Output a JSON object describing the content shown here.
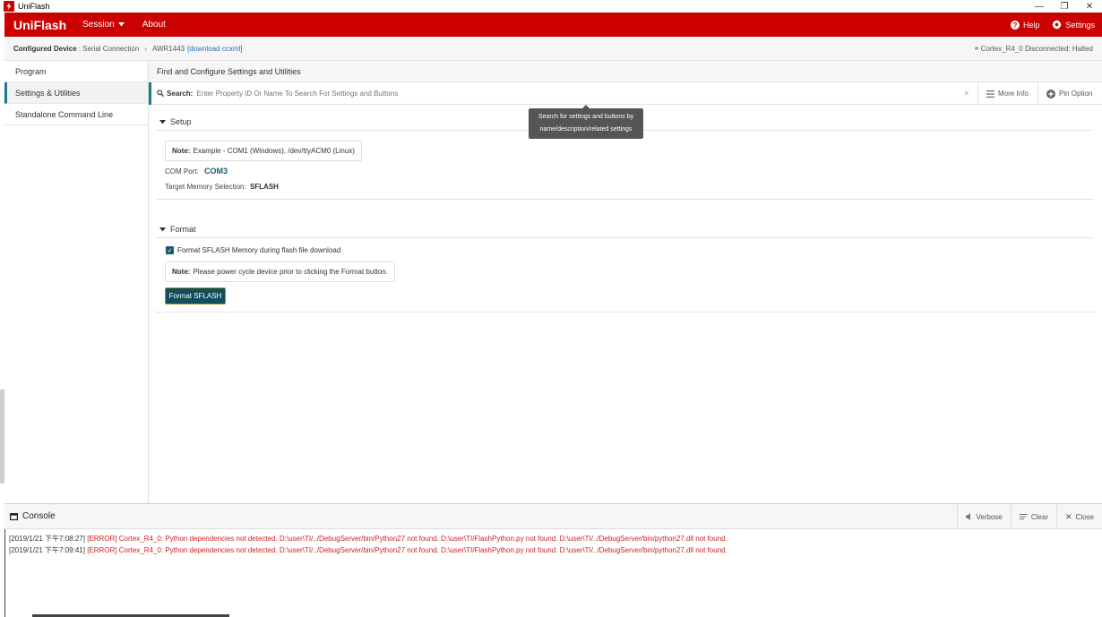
{
  "window": {
    "title": "UniFlash",
    "minimize": "—",
    "restore": "❐",
    "close": "✕"
  },
  "appbar": {
    "brand": "UniFlash",
    "menu": [
      {
        "label": "Session"
      },
      {
        "label": "About"
      }
    ],
    "help": "Help",
    "settings": "Settings"
  },
  "crumbs": {
    "label": "Configured Device",
    "connection": ": Serial Connection",
    "device": "AWR1443",
    "link": "[download ccxml]",
    "status": "Cortex_R4_0 Disconnected: Halted"
  },
  "sidebar": {
    "items": [
      {
        "label": "Program"
      },
      {
        "label": "Settings & Utilities"
      },
      {
        "label": "Standalone Command Line"
      }
    ]
  },
  "main": {
    "heading": "Find and Configure Settings and Utilities",
    "search_label": "Search:",
    "search_placeholder": "Enter Property ID Or Name To Search For Settings and Buttons",
    "clear": "×",
    "more_info": "More Info",
    "pin_option": "Pin Option",
    "tooltip_line1": "Search for settings and buttons by",
    "tooltip_line2": "name/description/related settings"
  },
  "setup": {
    "title": "Setup",
    "note_label": "Note:",
    "note_text": "Example - COM1 (Windows), /dev/ttyACM0 (Linux)",
    "com_label": "COM Port:",
    "com_value": "COM3",
    "mem_label": "Target Memory Selection:",
    "mem_value": "SFLASH"
  },
  "format": {
    "title": "Format",
    "checkbox_label": "Format SFLASH Memory during flash file download",
    "checked": true,
    "note_label": "Note:",
    "note_text": "Please power cycle device prior to clicking the Format button.",
    "button": "Format SFLASH"
  },
  "console": {
    "title": "Console",
    "verbose": "Verbose",
    "clear": "Clear",
    "close": "Close",
    "logs": [
      {
        "ts": "[2019/1/21 下午7:08:27]",
        "msg": "[ERROR] Cortex_R4_0: Python dependencies not detected. D:\\user\\TI/../DebugServer/bin/Python27 not found. D:\\user\\TI/FlashPython.py not found. D:\\user\\TI/../DebugServer/bin/python27.dll not found."
      },
      {
        "ts": "[2019/1/21 下午7:09:41]",
        "msg": "[ERROR] Cortex_R4_0: Python dependencies not detected. D:\\user\\TI/../DebugServer/bin/Python27 not found. D:\\user\\TI/FlashPython.py not found. D:\\user\\TI/../DebugServer/bin/python27.dll not found."
      }
    ]
  },
  "colors": {
    "brand_red": "#cc0000",
    "accent_teal": "#1a7a8a",
    "error_red": "#cc2222"
  }
}
